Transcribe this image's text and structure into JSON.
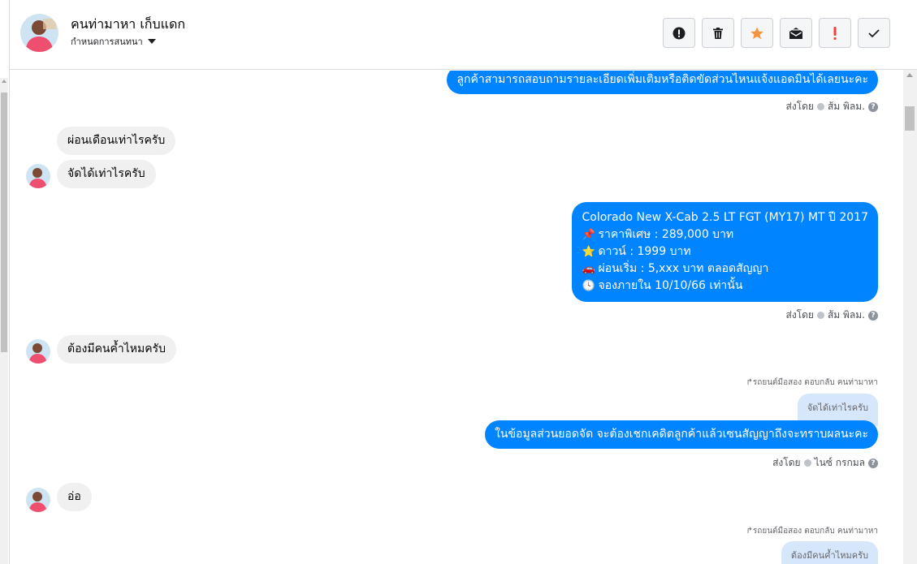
{
  "header": {
    "name": "คนท่ามาหา เก็บแดก",
    "subtitle": "กำหนดการสนทนา"
  },
  "actions": [
    {
      "icon": "alert-circle-icon",
      "name": "mark-spam-button"
    },
    {
      "icon": "trash-icon",
      "name": "delete-button"
    },
    {
      "icon": "star-icon",
      "name": "star-button"
    },
    {
      "icon": "mark-unread-icon",
      "name": "mark-unread-button"
    },
    {
      "icon": "exclamation-icon",
      "name": "follow-up-button"
    },
    {
      "icon": "checkmark-icon",
      "name": "done-button"
    }
  ],
  "colors": {
    "accent": "#0084ff",
    "incoming": "#f1f0f0",
    "quote": "#d7e7fb",
    "star": "#f7923a",
    "alert": "#fa3e3e"
  },
  "messages": {
    "m1_text": "ลูกค้าสามารถสอบถามรายละเอียดเพิ่มเติมหรือติดขัดส่วนไหนแจ้งแอดมินได้เลยนะคะ",
    "m1_sentby_prefix": "ส่งโดย",
    "m1_sender": "ส้ม พิลม.",
    "m2_text": "ผ่อนเดือนเท่าไรครับ",
    "m3_text": "จัดได้เท่าไรครับ",
    "m4_line1": "Colorado New X-Cab 2.5 LT FGT (MY17) MT ปี 2017",
    "m4_line2": "ราคาพิเศษ : 289,000 บาท",
    "m4_line3": "ดาวน์ : 1999 บาท",
    "m4_line4": "ผ่อนเริ่ม : 5,xxx บาท ตลอดสัญญา",
    "m4_line5": "จองภายใน 10/10/66 เท่านั้น",
    "m4_emoji1": "📌",
    "m4_emoji2": "⭐",
    "m4_emoji3": "🚗",
    "m4_emoji4": "🕓",
    "m4_sentby_prefix": "ส่งโดย",
    "m4_sender": "ส้ม พิลม.",
    "m5_text": "ต้องมีคนค้ำไหมครับ",
    "m6_reply_label": "รถยนต์มือสอง ตอบกลับ คนท่ามาหา",
    "m6_quote": "จัดได้เท่าไรครับ",
    "m6_text": "ในข้อมูลส่วนยอดจัด จะต้องเชกเคดิตลูกค้าแล้วเซนสัญญาถึงจะทราบผลนะคะ",
    "m6_sentby_prefix": "ส่งโดย",
    "m6_sender": "ไนซ์ กรกมล",
    "m7_text": "อ่อ",
    "m8_reply_label": "รถยนต์มือสอง ตอบกลับ คนท่ามาหา",
    "m8_quote": "ต้องมีคนค้ำไหมครับ"
  }
}
